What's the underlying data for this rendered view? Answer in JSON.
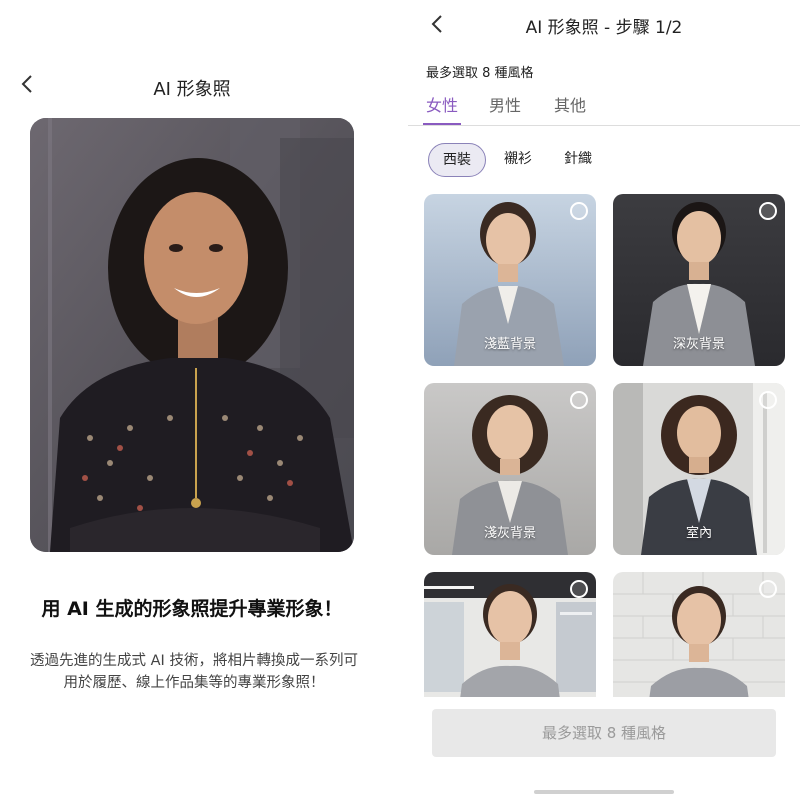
{
  "left": {
    "title": "AI 形象照",
    "back_icon": "chevron-left-icon",
    "headline": "用 AI 生成的形象照提升專業形象！",
    "description": "透過先進的生成式 AI 技術，將相片轉換成一系列可用於履歷、線上作品集等的專業形象照！"
  },
  "right": {
    "title": "AI 形象照 - 步驟 1/2",
    "back_icon": "chevron-left-icon",
    "max_label": "最多選取 8 種風格",
    "tabs": [
      {
        "label": "女性",
        "active": true
      },
      {
        "label": "男性",
        "active": false
      },
      {
        "label": "其他",
        "active": false
      }
    ],
    "chips": [
      {
        "label": "西裝",
        "active": true
      },
      {
        "label": "襯衫",
        "active": false
      },
      {
        "label": "針織",
        "active": false
      }
    ],
    "styles": [
      {
        "label": "淺藍背景",
        "selected": false
      },
      {
        "label": "深灰背景",
        "selected": false
      },
      {
        "label": "淺灰背景",
        "selected": false
      },
      {
        "label": "室內",
        "selected": false
      },
      {
        "label": "",
        "selected": false
      },
      {
        "label": "",
        "selected": false
      }
    ],
    "confirm_button": "最多選取 8 種風格"
  },
  "colors": {
    "accent": "#8a5bc0",
    "chip_border": "#8a82b8",
    "disabled_button": "#e8e8e8"
  }
}
